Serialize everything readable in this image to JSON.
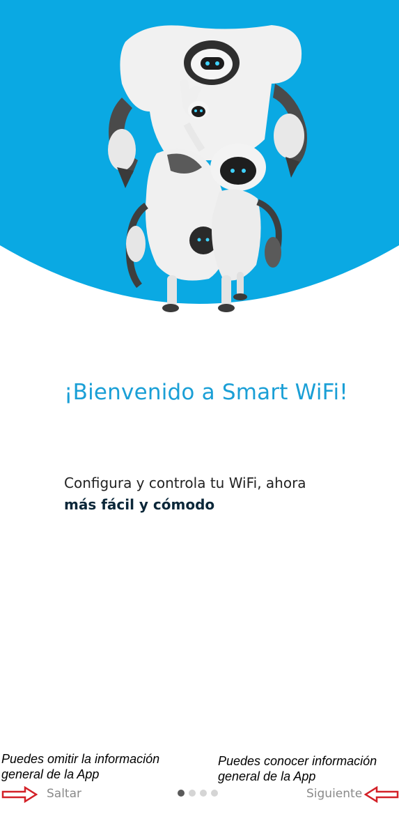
{
  "onboarding": {
    "title": "¡Bienvenido a Smart WiFi!",
    "subtitle_line1": "Configura y controla tu WiFi, ahora",
    "subtitle_line2": "más fácil y cómodo",
    "pager": {
      "count": 4,
      "active_index": 1
    }
  },
  "footer": {
    "skip_label": "Saltar",
    "next_label": "Siguiente"
  },
  "annotations": {
    "skip_note": "Puedes omitir la información general de la App",
    "next_note": "Puedes conocer información general de la App"
  },
  "colors": {
    "hero_blue": "#0aa9e3",
    "title_blue": "#1a9fd6",
    "annotation_arrow": "#d32027"
  },
  "icons": {
    "hero": "robots-illustration",
    "skip_pointer": "outline-arrow-right-icon",
    "next_pointer": "outline-arrow-left-icon"
  }
}
